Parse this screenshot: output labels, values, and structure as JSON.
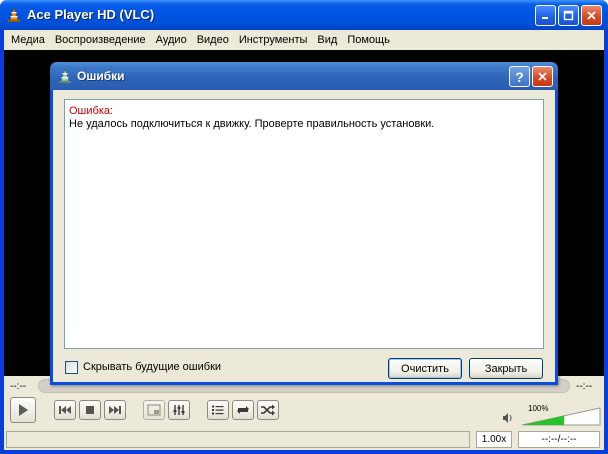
{
  "window": {
    "title": "Ace Player HD (VLC)"
  },
  "menu": [
    "Медиа",
    "Воспроизведение",
    "Аудио",
    "Видео",
    "Инструменты",
    "Вид",
    "Помощь"
  ],
  "controls": {
    "elapsed": "--:--",
    "remaining": "--:--",
    "volume_percent": "100%",
    "volume_level": 1.0,
    "speed": "1.00x",
    "timecode": "--:--/--:--"
  },
  "dialog": {
    "title": "Ошибки",
    "help_label": "?",
    "error_label": "Ошибка:",
    "error_message": "Не удалось подключиться к движку. Проверте правильность установки.",
    "hide_future_label": "Скрывать будущие ошибки",
    "hide_future_checked": false,
    "clear_label": "Очистить",
    "close_label": "Закрыть"
  },
  "icons": {
    "app": "vlc-cone-icon",
    "dialog": "vlc-cone-icon",
    "play": "play-icon",
    "prev": "previous-icon",
    "stop": "stop-icon",
    "next": "next-icon",
    "fullscreen": "fullscreen-icon",
    "equalizer": "equalizer-icon",
    "playlist": "playlist-icon",
    "loop": "loop-icon",
    "random": "shuffle-icon",
    "speaker": "speaker-icon"
  },
  "colors": {
    "xp_blue": "#0054e3",
    "error_red": "#cc0000",
    "volume_green": "#29c229"
  }
}
